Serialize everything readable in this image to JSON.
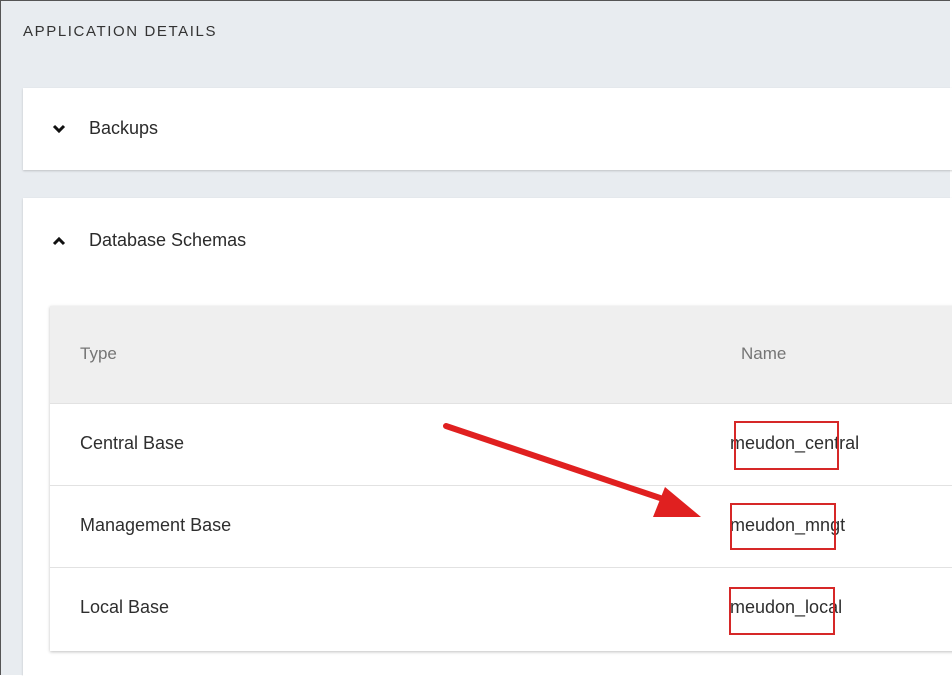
{
  "section": {
    "title": "APPLICATION DETAILS"
  },
  "panels": {
    "backups": {
      "label": "Backups",
      "state_icon": "chevron-down-icon"
    },
    "schemas": {
      "label": "Database Schemas",
      "state_icon": "chevron-up-icon"
    }
  },
  "table": {
    "headers": {
      "type": "Type",
      "name": "Name"
    },
    "rows": [
      {
        "type": "Central Base",
        "name": "meudon_central"
      },
      {
        "type": "Management Base",
        "name": "meudon_mngt"
      },
      {
        "type": "Local Base",
        "name": "meudon_local"
      }
    ]
  },
  "annotations": {
    "highlight_color": "#d62828",
    "arrow_color": "#e02020"
  }
}
